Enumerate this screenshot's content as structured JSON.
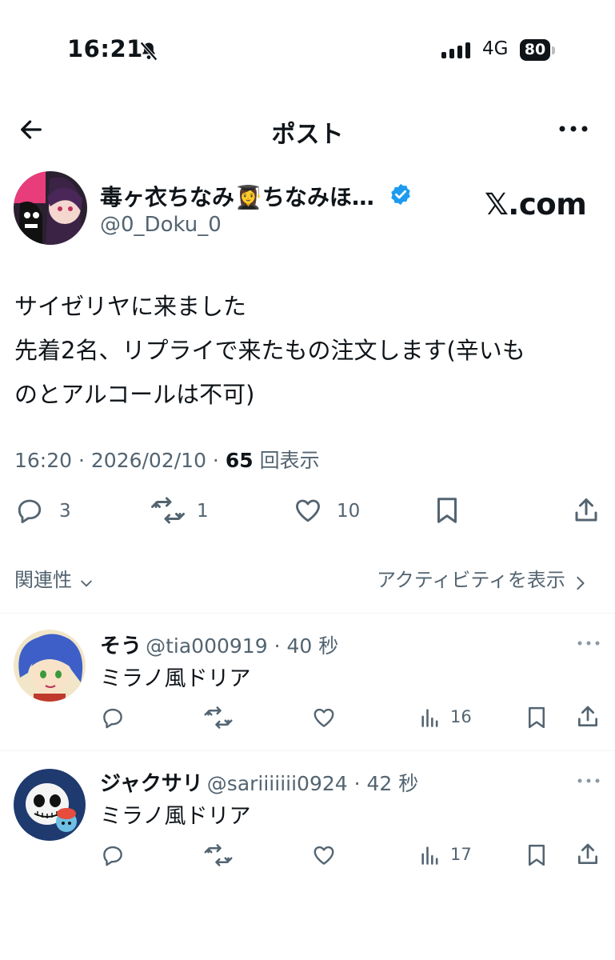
{
  "status_bar": {
    "time": "16:21",
    "network": "4G",
    "battery": "80"
  },
  "header": {
    "title": "ポスト"
  },
  "post": {
    "display_name": "毒ヶ衣ちなみ👩‍🎓ちなみほ…",
    "handle": "@0_Doku_0",
    "watermark": "𝕏.com",
    "text": "サイゼリヤに来ました\n先着2名、リプライで来たもの注文します(辛いも\nのとアルコールは不可)",
    "time": "16:20",
    "date": "2026/02/10",
    "views": "65",
    "views_label": "回表示",
    "replies": "3",
    "reposts": "1",
    "likes": "10"
  },
  "filters": {
    "relevance": "関連性",
    "activity": "アクティビティを表示"
  },
  "replies": [
    {
      "name": "そう",
      "handle": "@tia000919",
      "time": "40 秒",
      "text": "ミラノ風ドリア",
      "views": "16"
    },
    {
      "name": "ジャクサリ",
      "handle": "@sariiiiiii0924",
      "time": "42 秒",
      "text": "ミラノ風ドリア",
      "views": "17"
    }
  ],
  "colors": {
    "text": "#0f1419",
    "secondary": "#536471",
    "verified": "#1d9bf0",
    "divider": "#eff3f4"
  }
}
